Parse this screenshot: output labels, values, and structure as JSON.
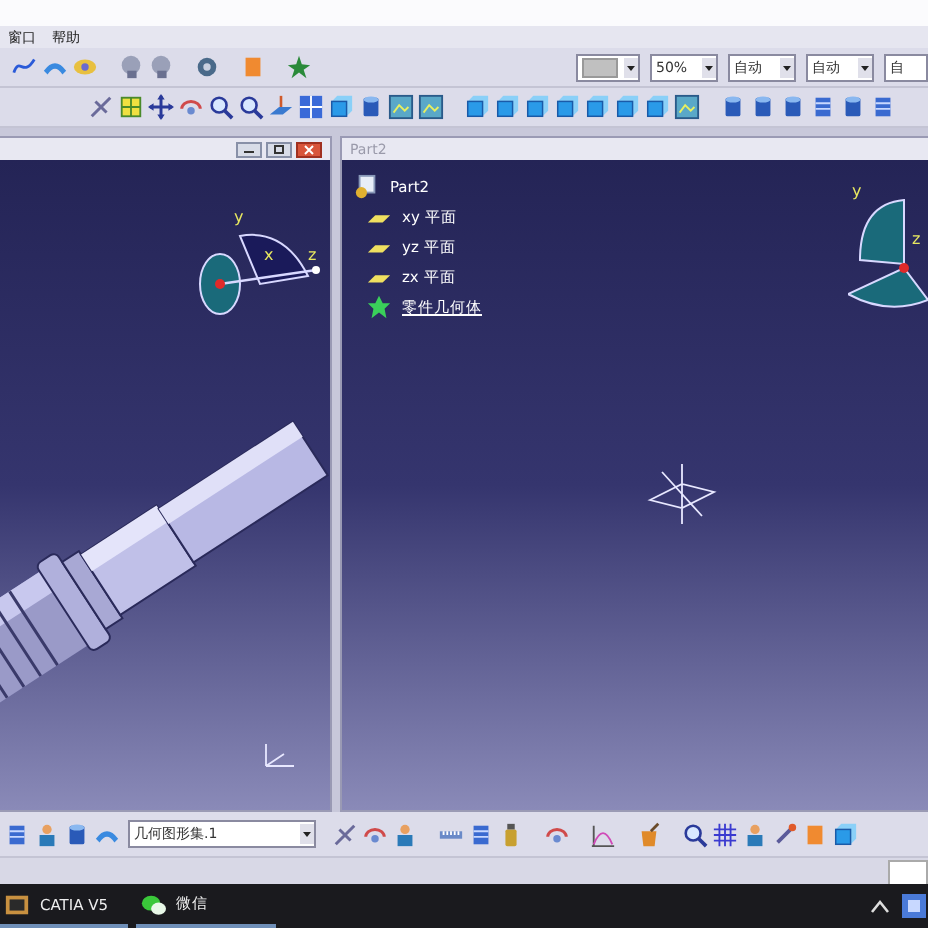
{
  "menu": [
    {
      "label": "窗口"
    },
    {
      "label": "帮助"
    }
  ],
  "style_fields": [
    {
      "kind": "swatch"
    },
    {
      "kind": "text",
      "value": "50%"
    },
    {
      "kind": "text",
      "value": "自动"
    },
    {
      "kind": "text",
      "value": "自动"
    },
    {
      "kind": "text",
      "value": "自"
    }
  ],
  "left_window": {
    "compass_labels": [
      "y",
      "x",
      "z"
    ]
  },
  "right_window": {
    "title": "Part2",
    "compass_labels": [
      "y",
      "z"
    ],
    "tree": {
      "label": "Part2",
      "kind": "part",
      "children": [
        {
          "label": "xy 平面",
          "kind": "plane"
        },
        {
          "label": "yz 平面",
          "kind": "plane"
        },
        {
          "label": "zx 平面",
          "kind": "plane"
        },
        {
          "label": "零件几何体",
          "kind": "body"
        }
      ]
    }
  },
  "bottom_toolbar": {
    "combo": "几何图形集.1"
  },
  "taskbar": [
    {
      "label": "CATIA V5",
      "kind": "catia"
    },
    {
      "label": "微信",
      "kind": "wechat"
    }
  ]
}
